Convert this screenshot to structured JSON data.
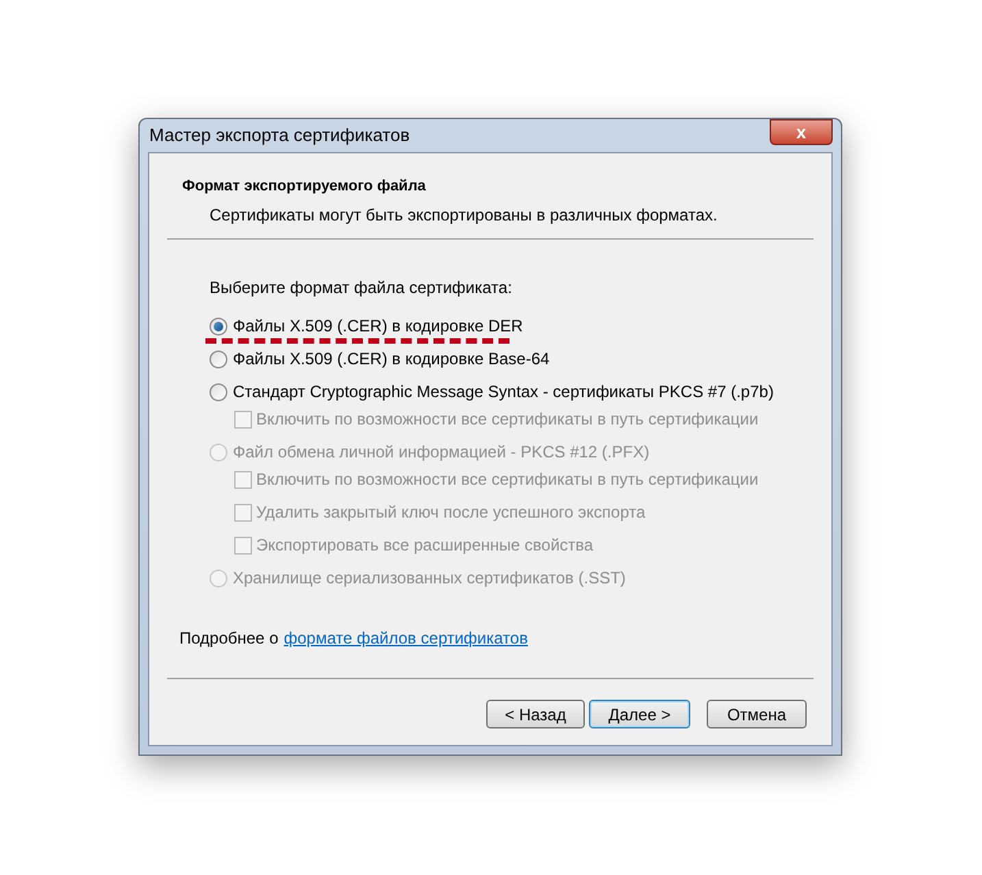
{
  "window": {
    "title": "Мастер экспорта сертификатов",
    "close_label": "x"
  },
  "header": {
    "title": "Формат экспортируемого файла",
    "subtitle": "Сертификаты могут быть экспортированы в различных форматах."
  },
  "prompt": "Выберите формат файла сертификата:",
  "options": [
    {
      "label": "Файлы X.509 (.CER) в кодировке DER",
      "selected": true,
      "disabled": false,
      "annotated": true
    },
    {
      "label": "Файлы X.509 (.CER) в кодировке Base-64",
      "selected": false,
      "disabled": false,
      "annotated": false
    },
    {
      "label": "Стандарт Cryptographic Message Syntax - сертификаты PKCS #7 (.p7b)",
      "selected": false,
      "disabled": false,
      "annotated": false,
      "children": [
        {
          "label": "Включить по возможности все сертификаты в путь сертификации",
          "checked": false,
          "disabled": true
        }
      ]
    },
    {
      "label": "Файл обмена личной информацией - PKCS #12 (.PFX)",
      "selected": false,
      "disabled": true,
      "annotated": false,
      "children": [
        {
          "label": "Включить по возможности все сертификаты в путь сертификации",
          "checked": false,
          "disabled": true
        },
        {
          "label": "Удалить закрытый ключ после успешного экспорта",
          "checked": false,
          "disabled": true
        },
        {
          "label": "Экспортировать все расширенные свойства",
          "checked": false,
          "disabled": true
        }
      ]
    },
    {
      "label": "Хранилище сериализованных сертификатов (.SST)",
      "selected": false,
      "disabled": true,
      "annotated": false
    }
  ],
  "more_info": {
    "text": "Подробнее о",
    "link": "формате файлов сертификатов"
  },
  "buttons": [
    {
      "label": "< Назад",
      "kind": "normal"
    },
    {
      "label": "Далее >",
      "kind": "default"
    },
    {
      "label": "Отмена",
      "kind": "cancel"
    }
  ]
}
